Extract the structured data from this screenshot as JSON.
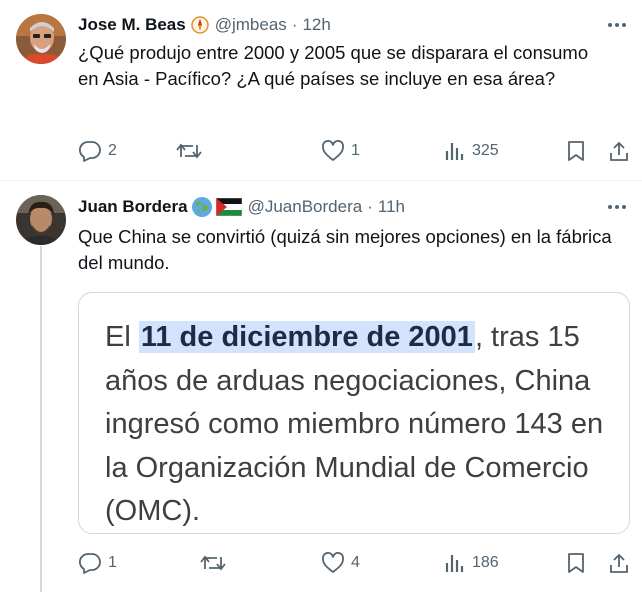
{
  "tweet1": {
    "display_name": "Jose M. Beas",
    "handle": "@jmbeas",
    "time": "12h",
    "text": "¿Qué produjo entre 2000 y 2005 que se disparara el consumo en Asia - Pacífico? ¿A qué países se incluye en esa área?",
    "replies": "2",
    "retweets": "",
    "likes": "1",
    "views": "325"
  },
  "tweet2": {
    "display_name": "Juan Bordera",
    "handle": "@JuanBordera",
    "time": "11h",
    "text": "Que China se convirtió (quizá sin mejores opciones) en la fábrica del mundo.",
    "image_text": {
      "before": "El ",
      "highlight": "11 de diciembre de 2001",
      "after": ", tras 15 años de arduas negociaciones, China ingresó como miembro número 143 en la Organización Mundial de Comercio (OMC)."
    },
    "replies": "1",
    "retweets": "",
    "likes": "4",
    "views": "186"
  },
  "separator_dot": "·",
  "colors": {
    "text": "#0f1419",
    "secondary": "#536471",
    "border": "#cfd9de",
    "highlight": "#d3e3fd"
  },
  "icons": {
    "more": "more-icon",
    "reply": "reply-icon",
    "retweet": "retweet-icon",
    "like": "like-icon",
    "views": "views-icon",
    "bookmark": "bookmark-icon",
    "share": "share-icon"
  }
}
